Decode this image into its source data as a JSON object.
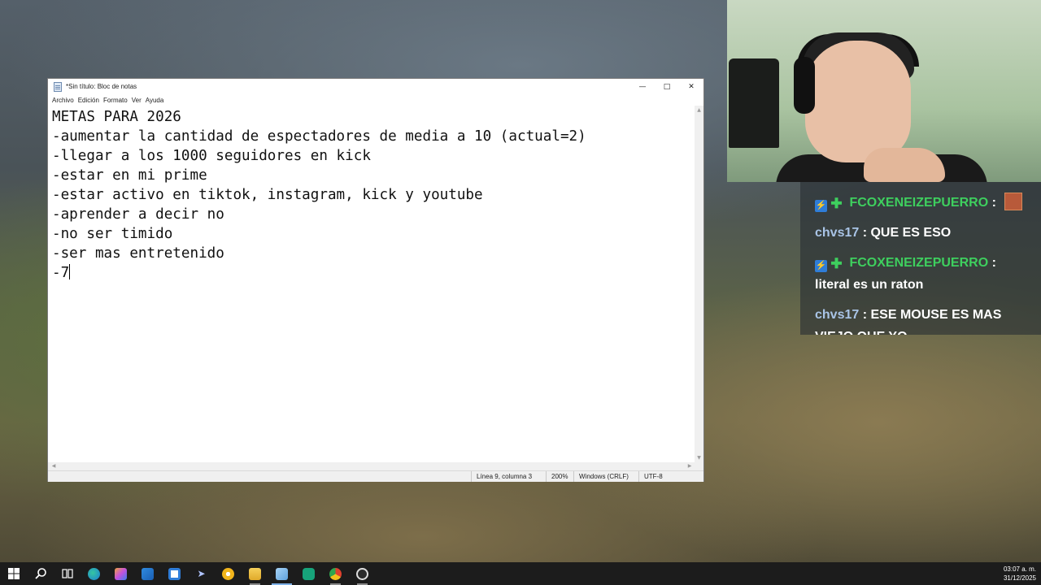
{
  "notepad": {
    "title": "*Sin título: Bloc de notas",
    "menu": [
      "Archivo",
      "Edición",
      "Formato",
      "Ver",
      "Ayuda"
    ],
    "lines": [
      "METAS PARA 2026",
      "-aumentar la cantidad de espectadores de media a 10 (actual=2)",
      "-llegar a los 1000 seguidores en kick",
      "-estar en mi prime",
      "-estar activo en tiktok, instagram, kick y youtube",
      "-aprender a decir no",
      "-no ser timido",
      "-ser mas entretenido",
      "-7"
    ],
    "status": {
      "position": "Línea 9, columna 3",
      "zoom": "200%",
      "line_ending": "Windows (CRLF)",
      "encoding": "UTF-8"
    }
  },
  "chat": {
    "messages": [
      {
        "user": "FCOXENEIZEPUERRO",
        "text": "",
        "user_color": "#3ecf5e",
        "badges": [
          "moderator-badge-icon",
          "verified-badge-icon"
        ],
        "emote": true
      },
      {
        "user": "chvs17",
        "text": "QUE ES ESO",
        "user_color": "#a9c4e6",
        "badges": [],
        "emote": false
      },
      {
        "user": "FCOXENEIZEPUERRO",
        "text": "literal es un raton",
        "user_color": "#3ecf5e",
        "badges": [
          "moderator-badge-icon",
          "verified-badge-icon"
        ],
        "emote": false
      },
      {
        "user": "chvs17",
        "text": "ESE MOUSE ES MAS VIEJO QUE YO",
        "user_color": "#a9c4e6",
        "badges": [],
        "emote": false
      }
    ]
  },
  "taskbar": {
    "time": "03:07 a. m.",
    "date": "31/12/2025",
    "icons": [
      "windows-start-icon",
      "search-icon",
      "task-view-icon",
      "edge-icon",
      "copilot-icon",
      "outlook-icon",
      "store-icon",
      "dev-icon",
      "chrome-canary-icon",
      "file-explorer-icon",
      "notepad-icon",
      "app-green-icon",
      "chrome-icon",
      "obs-icon"
    ]
  },
  "colors": {
    "taskbar_bg": "#1c1c1c",
    "window_bg": "#ffffff",
    "chat_user_green": "#3ecf5e",
    "chat_user_blue": "#a9c4e6"
  }
}
